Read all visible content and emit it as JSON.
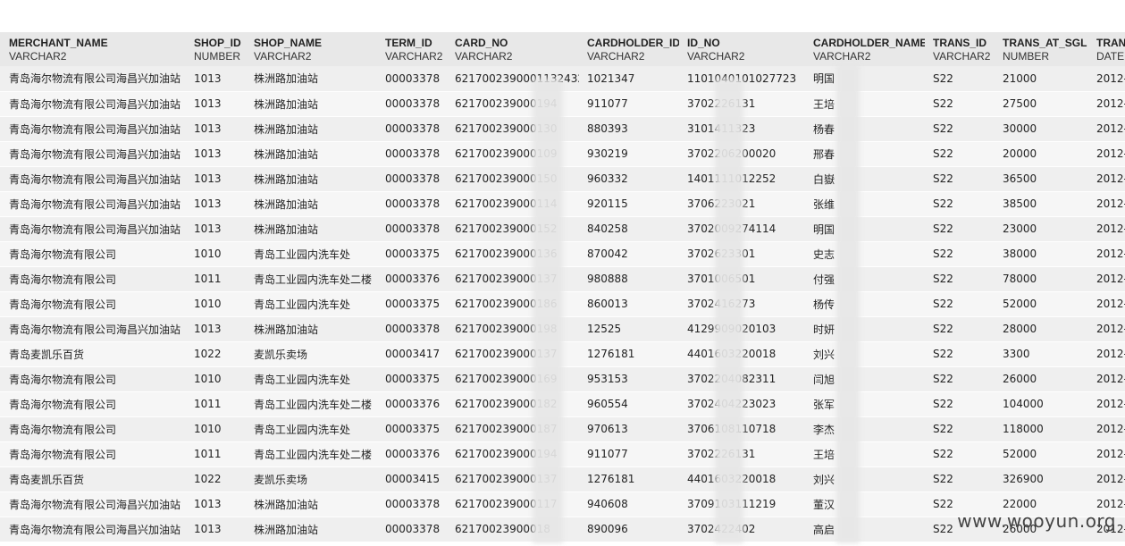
{
  "columns": [
    {
      "name": "MERCHANT_NAME",
      "type": "VARCHAR2"
    },
    {
      "name": "SHOP_ID",
      "type": "NUMBER"
    },
    {
      "name": "SHOP_NAME",
      "type": "VARCHAR2"
    },
    {
      "name": "TERM_ID",
      "type": "VARCHAR2"
    },
    {
      "name": "CARD_NO",
      "type": "VARCHAR2"
    },
    {
      "name": "CARDHOLDER_ID",
      "type": "VARCHAR2"
    },
    {
      "name": "ID_NO",
      "type": "VARCHAR2"
    },
    {
      "name": "CARDHOLDER_NAME",
      "type": "VARCHAR2"
    },
    {
      "name": "TRANS_ID",
      "type": "VARCHAR2"
    },
    {
      "name": "TRANS_AT_SGL",
      "type": "NUMBER"
    },
    {
      "name": "TRAN",
      "type": "DATE"
    }
  ],
  "rows": [
    [
      "青岛海尔物流有限公司海昌兴加油站",
      "1013",
      "株洲路加油站",
      "00003378",
      "62170023900011324328",
      "1021347",
      "1101040101027723",
      "明国",
      "S22",
      "21000",
      "2012-"
    ],
    [
      "青岛海尔物流有限公司海昌兴加油站",
      "1013",
      "株洲路加油站",
      "00003378",
      "621700239000194",
      "911077",
      "3702226131",
      "王培",
      "S22",
      "27500",
      "2012-"
    ],
    [
      "青岛海尔物流有限公司海昌兴加油站",
      "1013",
      "株洲路加油站",
      "00003378",
      "621700239000130",
      "880393",
      "3101411323",
      "杨春",
      "S22",
      "30000",
      "2012-"
    ],
    [
      "青岛海尔物流有限公司海昌兴加油站",
      "1013",
      "株洲路加油站",
      "00003378",
      "621700239000109",
      "930219",
      "3702206200020",
      "邢春",
      "S22",
      "20000",
      "2012-"
    ],
    [
      "青岛海尔物流有限公司海昌兴加油站",
      "1013",
      "株洲路加油站",
      "00003378",
      "621700239000150",
      "960332",
      "1401111012252",
      "白嶽",
      "S22",
      "36500",
      "2012-"
    ],
    [
      "青岛海尔物流有限公司海昌兴加油站",
      "1013",
      "株洲路加油站",
      "00003378",
      "621700239000114",
      "920115",
      "3706223021",
      "张维",
      "S22",
      "38500",
      "2012-"
    ],
    [
      "青岛海尔物流有限公司海昌兴加油站",
      "1013",
      "株洲路加油站",
      "00003378",
      "621700239000152",
      "840258",
      "3702009274114",
      "明国",
      "S22",
      "23000",
      "2012-"
    ],
    [
      "青岛海尔物流有限公司",
      "1010",
      "青岛工业园内洗车处",
      "00003375",
      "621700239000136",
      "870042",
      "3702623301",
      "史志",
      "S22",
      "38000",
      "2012-"
    ],
    [
      "青岛海尔物流有限公司",
      "1011",
      "青岛工业园内洗车处二楼",
      "00003376",
      "621700239000137",
      "980888",
      "3701006501",
      "付强",
      "S22",
      "78000",
      "2012-"
    ],
    [
      "青岛海尔物流有限公司",
      "1010",
      "青岛工业园内洗车处",
      "00003375",
      "621700239000186",
      "860013",
      "3702416273",
      "杨传",
      "S22",
      "52000",
      "2012-"
    ],
    [
      "青岛海尔物流有限公司海昌兴加油站",
      "1013",
      "株洲路加油站",
      "00003378",
      "621700239000198",
      "12525",
      "4129909020103",
      "时妍",
      "S22",
      "28000",
      "2012-"
    ],
    [
      "青岛麦凯乐百货",
      "1022",
      "麦凯乐卖场",
      "00003417",
      "621700239000137",
      "1276181",
      "4401603220018",
      "刘兴",
      "S22",
      "3300",
      "2012-"
    ],
    [
      "青岛海尔物流有限公司",
      "1010",
      "青岛工业园内洗车处",
      "00003375",
      "621700239000169",
      "953153",
      "3702204082311",
      "闫旭",
      "S22",
      "26000",
      "2012-"
    ],
    [
      "青岛海尔物流有限公司",
      "1011",
      "青岛工业园内洗车处二楼",
      "00003376",
      "621700239000182",
      "960554",
      "3702404223023",
      "张军",
      "S22",
      "104000",
      "2012-"
    ],
    [
      "青岛海尔物流有限公司",
      "1010",
      "青岛工业园内洗车处",
      "00003375",
      "621700239000187",
      "970613",
      "3706108110718",
      "李杰",
      "S22",
      "118000",
      "2012-"
    ],
    [
      "青岛海尔物流有限公司",
      "1011",
      "青岛工业园内洗车处二楼",
      "00003376",
      "621700239000194",
      "911077",
      "3702226131",
      "王培",
      "S22",
      "52000",
      "2012-"
    ],
    [
      "青岛麦凯乐百货",
      "1022",
      "麦凯乐卖场",
      "00003415",
      "621700239000137",
      "1276181",
      "4401603220018",
      "刘兴",
      "S22",
      "326900",
      "2012-"
    ],
    [
      "青岛海尔物流有限公司海昌兴加油站",
      "1013",
      "株洲路加油站",
      "00003378",
      "621700239000117",
      "940608",
      "3709103111219",
      "董汉",
      "S22",
      "22000",
      "2012-"
    ],
    [
      "青岛海尔物流有限公司海昌兴加油站",
      "1013",
      "株洲路加油站",
      "00003378",
      "62170023900018",
      "890096",
      "3702422402",
      "高启",
      "S22",
      "26000",
      "2012-"
    ]
  ],
  "watermark": "www.wooyun.org"
}
